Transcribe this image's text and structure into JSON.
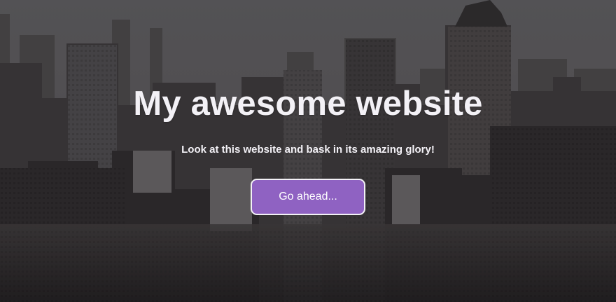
{
  "hero": {
    "title": "My awesome website",
    "subtitle": "Look at this website and bask in its amazing glory!",
    "button_label": "Go ahead..."
  },
  "colors": {
    "button_fill": "#8f62c2",
    "button_border": "#f3f1f6",
    "text": "#f3f1f6",
    "sky": "#5d5b5e"
  },
  "background": {
    "subject": "city skyline photo"
  }
}
